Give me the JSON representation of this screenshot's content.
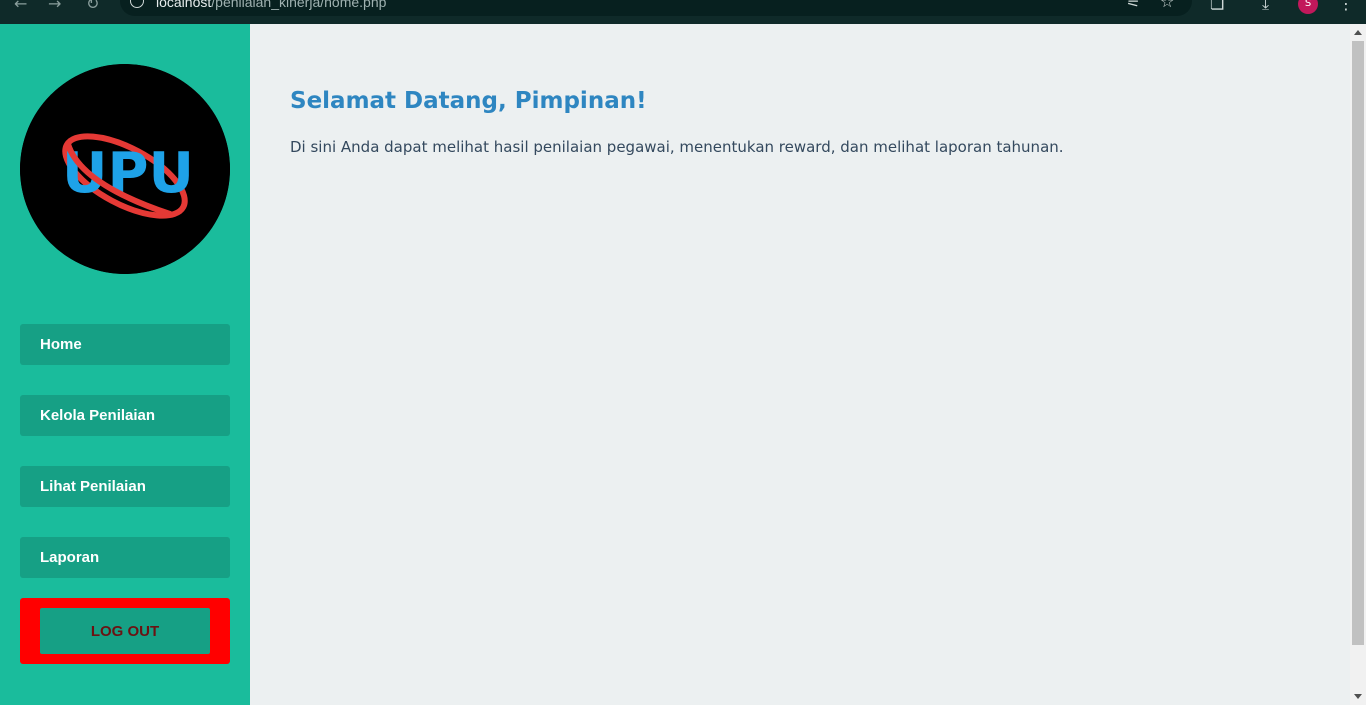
{
  "browser": {
    "url_host": "localhost",
    "url_path": "/penilaian_kinerja/home.php",
    "avatar_letter": "S"
  },
  "brand": {
    "logo_text": "UPU",
    "colors": {
      "ring": "#e53935",
      "letters": "#1ea2e8",
      "circle": "#000000"
    }
  },
  "sidebar": {
    "items": [
      {
        "label": "Home"
      },
      {
        "label": "Kelola Penilaian"
      },
      {
        "label": "Lihat Penilaian"
      },
      {
        "label": "Laporan"
      }
    ],
    "logout_label": "LOG OUT"
  },
  "main": {
    "title": "Selamat Datang, Pimpinan!",
    "description": "Di sini Anda dapat melihat hasil penilaian pegawai, menentukan reward, dan melihat laporan tahunan."
  },
  "colors": {
    "sidebar_bg": "#1abc9c",
    "menu_bg": "#16a085",
    "logout_frame": "#ff0000",
    "logout_text": "#6b1212",
    "title_color": "#2e86c1",
    "text_color": "#34495e",
    "page_bg": "#ecf0f1"
  }
}
